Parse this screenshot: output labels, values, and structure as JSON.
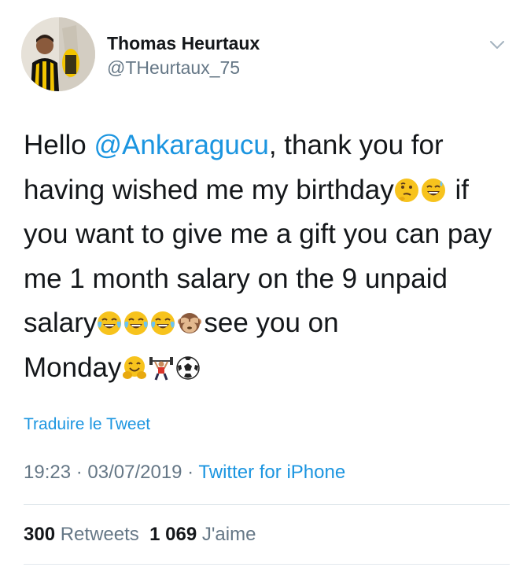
{
  "author": {
    "name": "Thomas Heurtaux",
    "handle": "@THeurtaux_75"
  },
  "tweet": {
    "line1_pre": "Hello ",
    "mention": "@Ankaragucu",
    "line1_post": ", thank you for",
    "line2": "having wished me my birthday",
    "line2_post": " if",
    "line3": "you want to give me a gift you can pay",
    "line4": "me 1 month salary on the 9 unpaid",
    "line5_pre": "salary",
    "line5_post": "see you on",
    "line6": "Monday",
    "emojis": [
      "thinking-face",
      "sweat-smile",
      "joy",
      "joy",
      "joy",
      "see-no-evil-monkey",
      "hugging-face",
      "weightlifter",
      "soccer-ball"
    ]
  },
  "translate_label": "Traduire le Tweet",
  "meta": {
    "time": "19:23",
    "date": "03/07/2019",
    "separator": " · ",
    "source": "Twitter for iPhone"
  },
  "stats": {
    "retweets_count": "300",
    "retweets_label": "Retweets",
    "likes_count": "1 069",
    "likes_label": "J'aime"
  },
  "colors": {
    "link": "#1b95e0",
    "muted": "#657786",
    "text": "#14171a",
    "divider": "#e1e8ed"
  }
}
